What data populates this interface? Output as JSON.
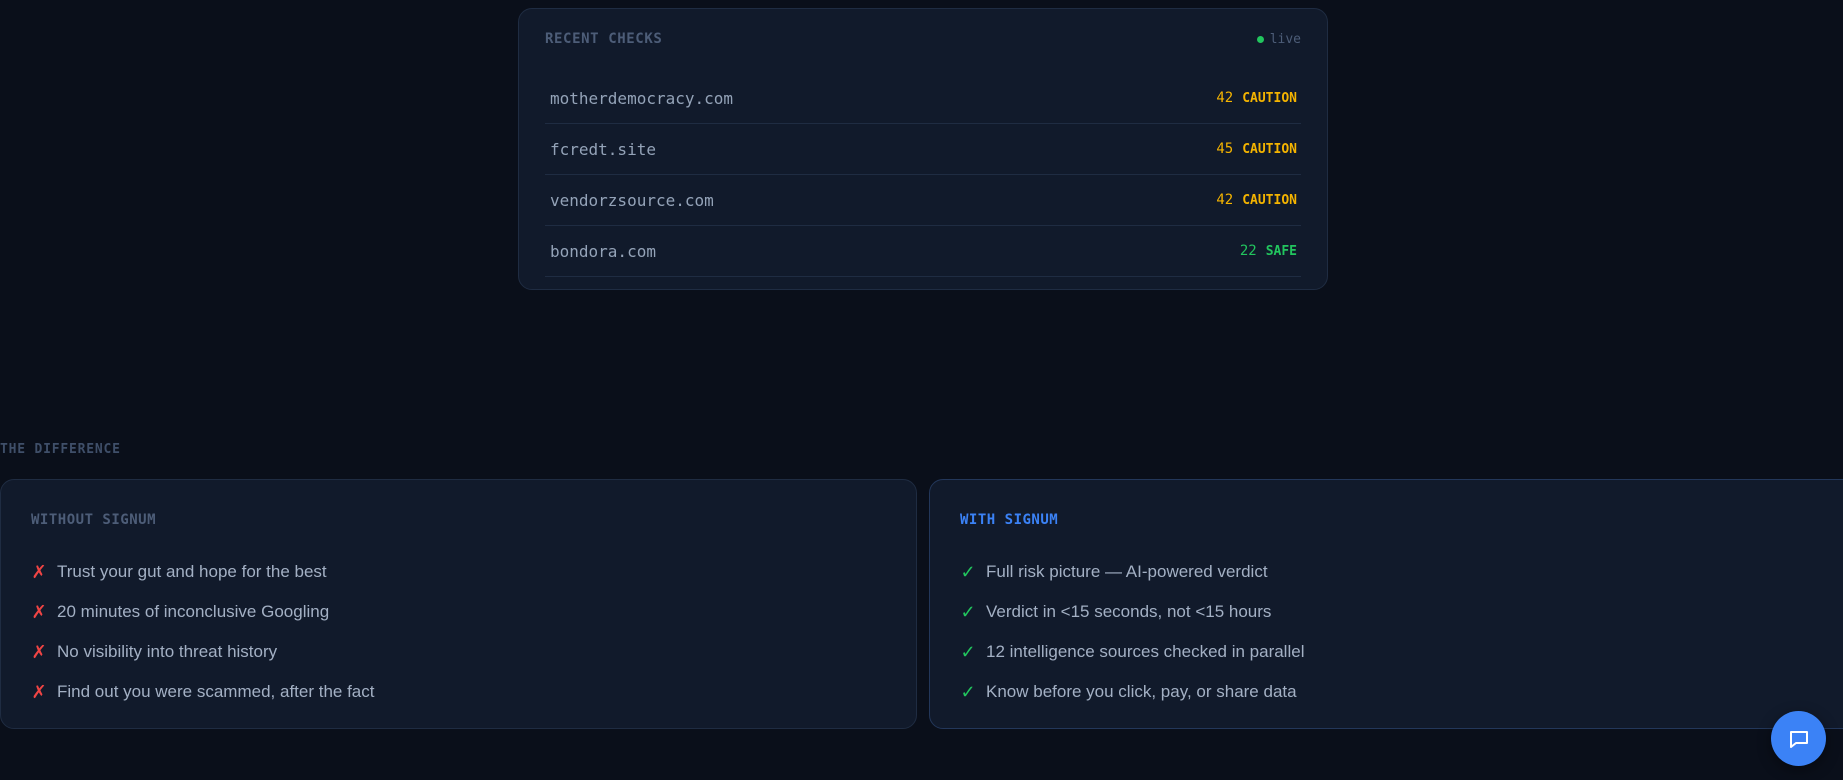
{
  "recent_checks": {
    "title": "RECENT CHECKS",
    "live_label": "live",
    "rows": [
      {
        "domain": "motherdemocracy.com",
        "score": "42",
        "verdict": "CAUTION",
        "status": "caution"
      },
      {
        "domain": "fcredt.site",
        "score": "45",
        "verdict": "CAUTION",
        "status": "caution"
      },
      {
        "domain": "vendorzsource.com",
        "score": "42",
        "verdict": "CAUTION",
        "status": "caution"
      },
      {
        "domain": "bondora.com",
        "score": "22",
        "verdict": "SAFE",
        "status": "safe"
      }
    ]
  },
  "difference": {
    "label": "THE DIFFERENCE",
    "without": {
      "title": "WITHOUT SIGNUM",
      "mark": "✗",
      "items": [
        "Trust your gut and hope for the best",
        "20 minutes of inconclusive Googling",
        "No visibility into threat history",
        "Find out you were scammed, after the fact"
      ]
    },
    "with": {
      "title": "WITH SIGNUM",
      "mark": "✓",
      "items": [
        "Full risk picture — AI-powered verdict",
        "Verdict in <15 seconds, not <15 hours",
        "12 intelligence sources checked in parallel",
        "Know before you click, pay, or share data"
      ]
    }
  },
  "chat_button": {
    "icon": "chat-bubble-icon"
  },
  "colors": {
    "background": "#0a0f1a",
    "card": "#111a2b",
    "accent": "#3b82f6",
    "caution": "#f5b400",
    "safe": "#22c55e",
    "danger": "#ef4444"
  }
}
